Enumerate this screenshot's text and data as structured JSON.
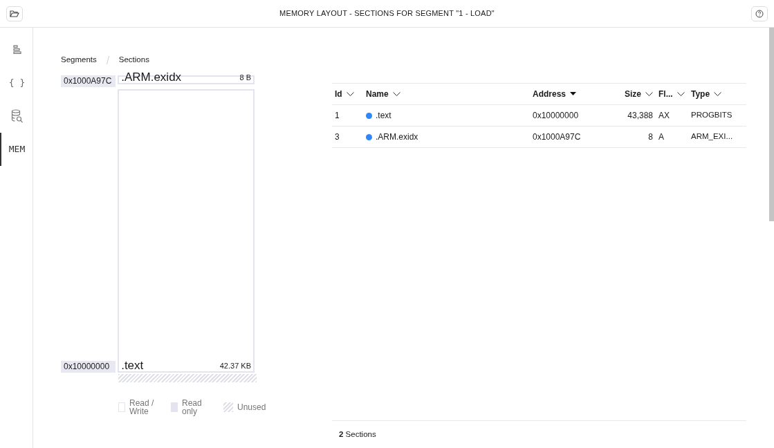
{
  "window": {
    "title": "MEMORY LAYOUT - SECTIONS FOR SEGMENT \"1 - LOAD\""
  },
  "sidebar": {
    "items": [
      {
        "kind": "lines",
        "selected": false
      },
      {
        "kind": "text",
        "label": "{ }",
        "selected": false
      },
      {
        "kind": "database",
        "selected": false
      },
      {
        "kind": "text",
        "label": "MEM",
        "selected": true
      }
    ]
  },
  "breadcrumb": [
    "Segments",
    "Sections"
  ],
  "memory_map": {
    "sections": [
      {
        "name": ".ARM.exidx",
        "size": "8 B",
        "address": "0x1000A97C",
        "kind": "small"
      },
      {
        "name": ".text",
        "size": "42.37 KB",
        "address": "0x10000000",
        "kind": "large"
      }
    ],
    "legend": [
      {
        "kind": "readwrite",
        "label": "Read / Write"
      },
      {
        "kind": "readonly",
        "label": "Read only"
      },
      {
        "kind": "unused",
        "label": "Unused"
      }
    ]
  },
  "table": {
    "columns": [
      {
        "label": "Id",
        "sorted": false
      },
      {
        "label": "Name",
        "sorted": false
      },
      {
        "label": "Address",
        "sorted": true
      },
      {
        "label": "Size",
        "sorted": false
      },
      {
        "label": "Fl...",
        "sorted": false
      },
      {
        "label": "Type",
        "sorted": false
      }
    ],
    "rows": [
      {
        "id": "1",
        "name": ".text",
        "color": "#2f86f6",
        "address": "0x10000000",
        "size": "43,388",
        "flags": "AX",
        "type": "PROGBITS"
      },
      {
        "id": "3",
        "name": ".ARM.exidx",
        "color": "#2f86f6",
        "address": "0x1000A97C",
        "size": "8",
        "flags": "A",
        "type": "ARM_EXI..."
      }
    ]
  },
  "footer": "**2** Sections"
}
